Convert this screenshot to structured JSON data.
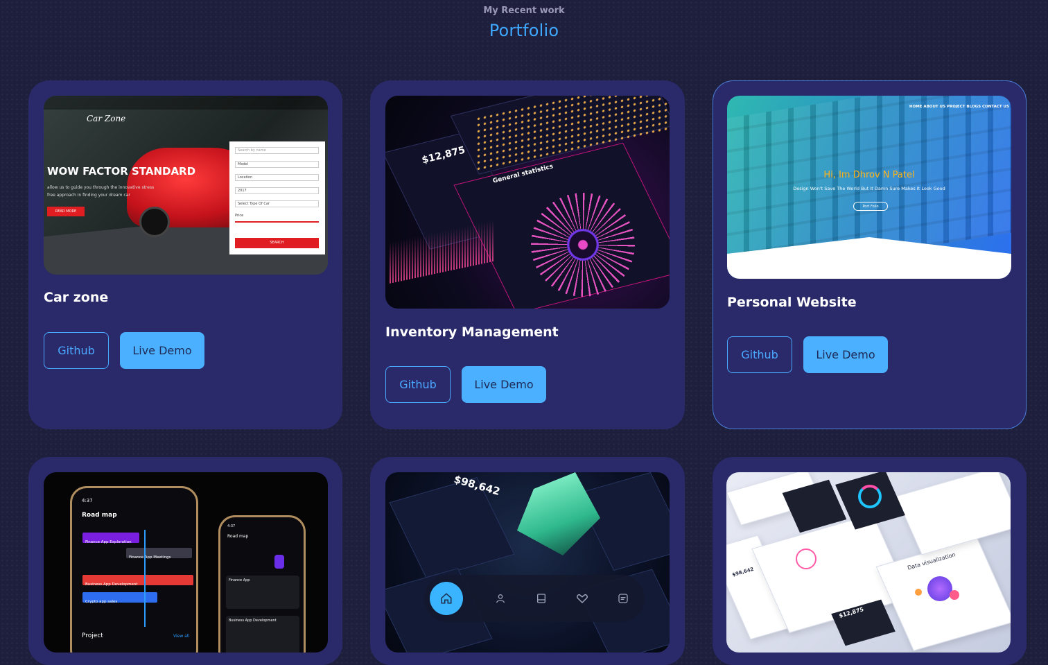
{
  "header": {
    "subtitle": "My Recent work",
    "title": "Portfolio"
  },
  "projects": [
    {
      "title": "Car zone",
      "github_label": "Github",
      "demo_label": "Live Demo",
      "preview": {
        "logo": "Car Zone",
        "headline": "WOW FACTOR STANDARD",
        "tagline": "allow us to guide you through the innovative stress free approach in finding your dream car",
        "read_more": "READ MORE",
        "form": {
          "search_placeholder": "Search by name",
          "model": "Model",
          "location": "Location",
          "year": "2017",
          "car_type": "Select Type Of Car",
          "price_label": "Price",
          "search_button": "SEARCH"
        }
      }
    },
    {
      "title": "Inventory Management",
      "github_label": "Github",
      "demo_label": "Live Demo",
      "preview": {
        "amount": "$12,875",
        "section": "General statistics"
      }
    },
    {
      "title": "Personal Website",
      "github_label": "Github",
      "demo_label": "Live Demo",
      "preview": {
        "nav": "HOME   ABOUT US   PROJECT   BLOGS   CONTACT US",
        "name": "Hi, Im Dhrov N Patel",
        "tagline": "Design Won't Save The World But It Damn Sure Makes It Look Good",
        "button": "Port Folio"
      }
    },
    {
      "preview": {
        "time": "4:37",
        "screen_title": "Road map",
        "tasks": [
          "Finance App Exploration",
          "Finance App Meetings",
          "Business App Development",
          "Crypto app sales"
        ],
        "footer": "Project",
        "view_all": "View all",
        "secondary_items": [
          "Finance App",
          "Business App Development"
        ]
      }
    },
    {
      "preview": {
        "amount": "$98,642"
      },
      "bottom_nav": {
        "icons": [
          "home-icon",
          "user-icon",
          "document-icon",
          "handshake-icon",
          "message-icon"
        ],
        "active_color": "#3ab4ff"
      }
    },
    {
      "preview": {
        "section_title": "Data visualization",
        "amount": "$12,875",
        "amount_secondary": "$98,642"
      }
    }
  ]
}
